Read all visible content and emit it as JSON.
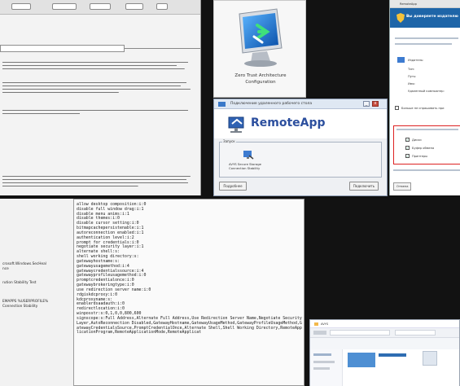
{
  "zero_trust": {
    "label_line1": "Zero Trust Architecture",
    "label_line2": "Configuration"
  },
  "remoteapp": {
    "title": "Подключение удаленного рабочего стола",
    "brand": "RemoteApp",
    "group_label": "Запуск",
    "app_label_line1": "AVYS Secure Storage",
    "app_label_line2": "Connection Stability",
    "button_left": "Подробнее",
    "button_right": "Подключить"
  },
  "right_dialog": {
    "title": "RemoteApp",
    "header": "Вы доверяете издателю",
    "items": [
      "Издатель:",
      "Тип:",
      "Путь:",
      "Имя:",
      "Удаленный компьютер:"
    ],
    "checkbox_text": "Больше не спрашивать при",
    "box_options": [
      "Диски",
      "Буфер обмена",
      "Принтеры"
    ],
    "cancel": "Отмена"
  },
  "bottom_left": {
    "lines": [
      "crosoft.Windows.SecHeal",
      "nce",
      "",
      "rution Stability Test",
      "",
      "",
      "EMAPPS %USERPROFILE%",
      "Connection Stability"
    ]
  },
  "rdp_file": {
    "lines": [
      "allow desktop composition:i:0",
      "disable full window drag:i:1",
      "disable menu anims:i:1",
      "disable themes:i:0",
      "disable cursor setting:i:0",
      "bitmapcachepersistenable:i:1",
      "autoreconnection enabled:i:1",
      "authentication level:i:2",
      "prompt for credentials:i:0",
      "negotiate security layer:i:1",
      "alternate shell:s:",
      "shell working directory:s:",
      "gatewayhostname:s:",
      "gatewayusagemethod:i:4",
      "gatewaycredentialssource:i:4",
      "gatewayprofileusagemethod:i:0",
      "promptcredentialonce:i:0",
      "gatewaybrokeringtype:i:0",
      "use redirection server name:i:0",
      "rdgiskdcproxy:i:0",
      "kdcproxyname:s:",
      "enablerdsaadauth:i:0",
      "redirectlocation:i:0",
      "winposstr:s:0,1,0,0,800,600",
      "signscope:s:Full Address,Alternate Full Address,Use Redirection Server Name,Negotiate Security Layer,AutoReconnection Disabled,GatewayHostname,GatewayUsageMethod,GatewayProfileUsageMethod,GatewayCredentialsSource,PromptCredentialOnce,Alternate Shell,Shell Working Directory,RemoteApplicationProgram,RemoteApplicationMode,RemoteApplicat"
    ]
  },
  "explorer": {
    "title": "AVYS"
  }
}
